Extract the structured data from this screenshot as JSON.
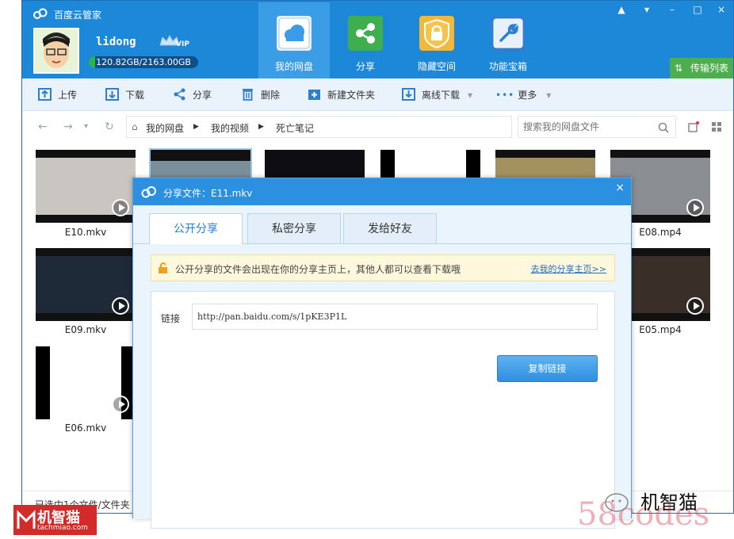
{
  "app": {
    "title": "百度云管家"
  },
  "user": {
    "name": "lidong",
    "vip_badge": "VIP",
    "quota_text": "120.82GB/2163.00GB",
    "quota_used_fraction": 0.056
  },
  "nav": [
    {
      "label": "我的网盘",
      "icon": "cloud-icon",
      "active": true
    },
    {
      "label": "分享",
      "icon": "share-icon",
      "active": false
    },
    {
      "label": "隐藏空间",
      "icon": "lock-icon",
      "active": false
    },
    {
      "label": "功能宝箱",
      "icon": "wrench-icon",
      "active": false
    }
  ],
  "window_controls": {
    "notify": "▲",
    "menu": "▾",
    "minimize": "–",
    "maximize": "□",
    "close": "×"
  },
  "transfer_label": "传输列表",
  "toolbar": {
    "upload": "上传",
    "download": "下载",
    "share": "分享",
    "delete": "删除",
    "new_folder": "新建文件夹",
    "offline": "离线下载",
    "more": "更多"
  },
  "breadcrumb": [
    "我的网盘",
    "我的视频",
    "死亡笔记"
  ],
  "search": {
    "placeholder": "搜索我的网盘文件"
  },
  "files": [
    {
      "name": "E10.mkv",
      "color": "#c9c5c0"
    },
    {
      "name": "",
      "color": "#7a8f9a"
    },
    {
      "name": "",
      "color": "#0e0e12"
    },
    {
      "name": "",
      "color": "#ffffff"
    },
    {
      "name": "",
      "color": "#a39160"
    },
    {
      "name": "E08.mp4",
      "color": "#8a8e92"
    },
    {
      "name": "E09.mkv",
      "color": "#1e2a38"
    },
    {
      "name": "E05.mp4",
      "color": "#3a2e28"
    },
    {
      "name": "E06.mkv",
      "color": "#ffffff"
    }
  ],
  "status": {
    "text": "已选中1个文件/文件夹"
  },
  "dialog": {
    "title": "分享文件：E11.mkv",
    "close": "×",
    "tabs": [
      "公开分享",
      "私密分享",
      "发给好友"
    ],
    "notice_text": "公开分享的文件会出现在你的分享主页上，其他人都可以查看下载哦",
    "notice_link": "去我的分享主页>>",
    "link_label": "链接",
    "link_value": "http://pan.baidu.com/s/1pKE3P1L",
    "copy_button": "复制链接"
  },
  "watermark": {
    "brand": "机智猫",
    "brand_sub": "tachmiao.com",
    "text1": "机智猫",
    "text2": "58codes"
  },
  "colors": {
    "title_bar": "#1e88d8",
    "dialog_title": "#2a90df",
    "transfer": "#4cae4c",
    "copy_button": "#2f8ee0"
  }
}
